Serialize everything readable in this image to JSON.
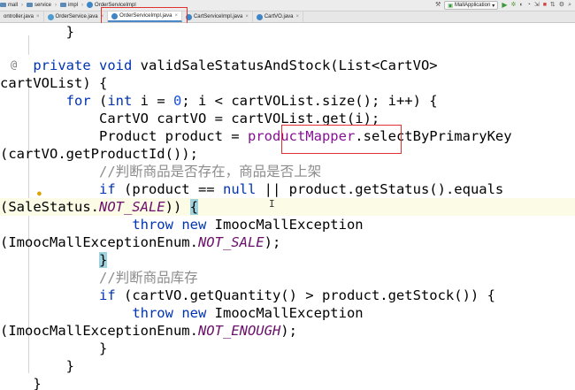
{
  "breadcrumb": [
    {
      "label": "mall",
      "icon": "folder-icon"
    },
    {
      "label": "service",
      "icon": "folder-icon"
    },
    {
      "label": "impl",
      "icon": "folder-icon"
    },
    {
      "label": "OrderServiceImpl",
      "icon": "class-icon"
    }
  ],
  "run_config": {
    "label": "MallApplication"
  },
  "tabs": [
    {
      "label": "ontroller.java"
    },
    {
      "label": "OrderService.java"
    },
    {
      "label": "OrderServiceImpl.java"
    },
    {
      "label": "CartServiceImpl.java"
    },
    {
      "label": "CartVO.java"
    }
  ],
  "active_tab_index": 2,
  "code_lines": [
    "        }",
    "",
    "    private void validSaleStatusAndStock(List<CartVO>",
    "cartVOList) {",
    "        for (int i = 0; i < cartVOList.size(); i++) {",
    "            CartVO cartVO = cartVOList.get(i);",
    "            Product product = productMapper.selectByPrimaryKey",
    "(cartVO.getProductId());",
    "            //判断商品是否存在，商品是否上架",
    "            if (product == null || product.getStatus().equals",
    "(SaleStatus.NOT_SALE)) {",
    "                throw new ImoocMallException",
    "(ImoocMallExceptionEnum.NOT_SALE);",
    "            }",
    "            //判断商品库存",
    "            if (cartVO.getQuantity() > product.getStock()) {",
    "                throw new ImoocMallException",
    "(ImoocMallExceptionEnum.NOT_ENOUGH);",
    "            }",
    "        }",
    "    }"
  ],
  "gutter_marks": {
    "override": "@"
  },
  "colors": {
    "keyword": "#0033b3",
    "constant": "#6a0f6a",
    "comment": "#8c8c8c",
    "number": "#1750eb",
    "highlight_box": "#e03030"
  }
}
